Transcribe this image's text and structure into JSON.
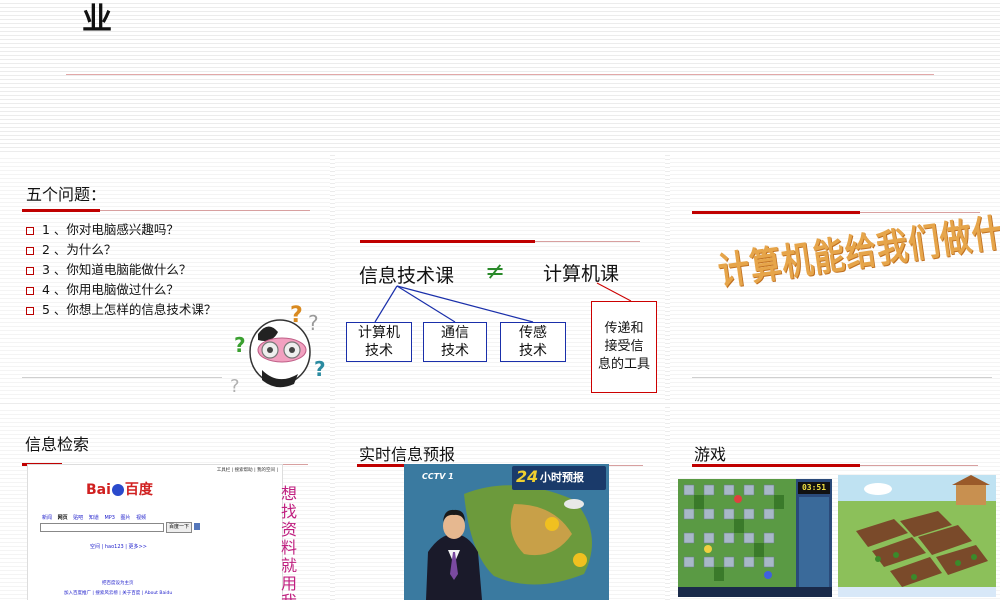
{
  "header": {
    "title_char": "业"
  },
  "slides": {
    "questions": {
      "title": "五个问题：",
      "items": [
        "1 、你对电脑感兴趣吗？",
        "2 、为什么？",
        "3 、你知道电脑能做什么？",
        "4 、你用电脑做过什么？",
        "5 、你想上怎样的信息技术课？"
      ]
    },
    "diagram": {
      "left_label": "信息技术课",
      "neq_symbol": "≠",
      "right_label": "计算机课",
      "boxes": [
        {
          "line1": "计算机",
          "line2": "技术"
        },
        {
          "line1": "通信",
          "line2": "技术"
        },
        {
          "line1": "传感",
          "line2": "技术"
        }
      ],
      "tool_box": {
        "line1": "传递和",
        "line2": "接受信",
        "line3": "息的工具"
      }
    },
    "question_art": {
      "text": "计算机能给我们做什么？"
    },
    "search": {
      "title": "信息检索",
      "vertical_text": "想找资料就用我",
      "baidu": {
        "logo_bai": "Bai",
        "logo_du": "百度",
        "top_links": "工具栏 | 搜索帮助 | 我的空间 |",
        "nav": [
          "新闻",
          "网页",
          "贴吧",
          "知道",
          "MP3",
          "图片",
          "视频"
        ],
        "button": "百度一下",
        "mid_links": "空间 | hao123 | 更多>>",
        "home_link": "把百度设为主页",
        "footer_links": "加入百度推广 | 搜索风云榜 | 关于百度 | About Baidu"
      }
    },
    "weather": {
      "title": "实时信息预报",
      "channel": "CCTV 1",
      "badge_num": "24",
      "badge_text": "小时预报"
    },
    "games": {
      "title": "游戏",
      "score": "03:51"
    }
  }
}
